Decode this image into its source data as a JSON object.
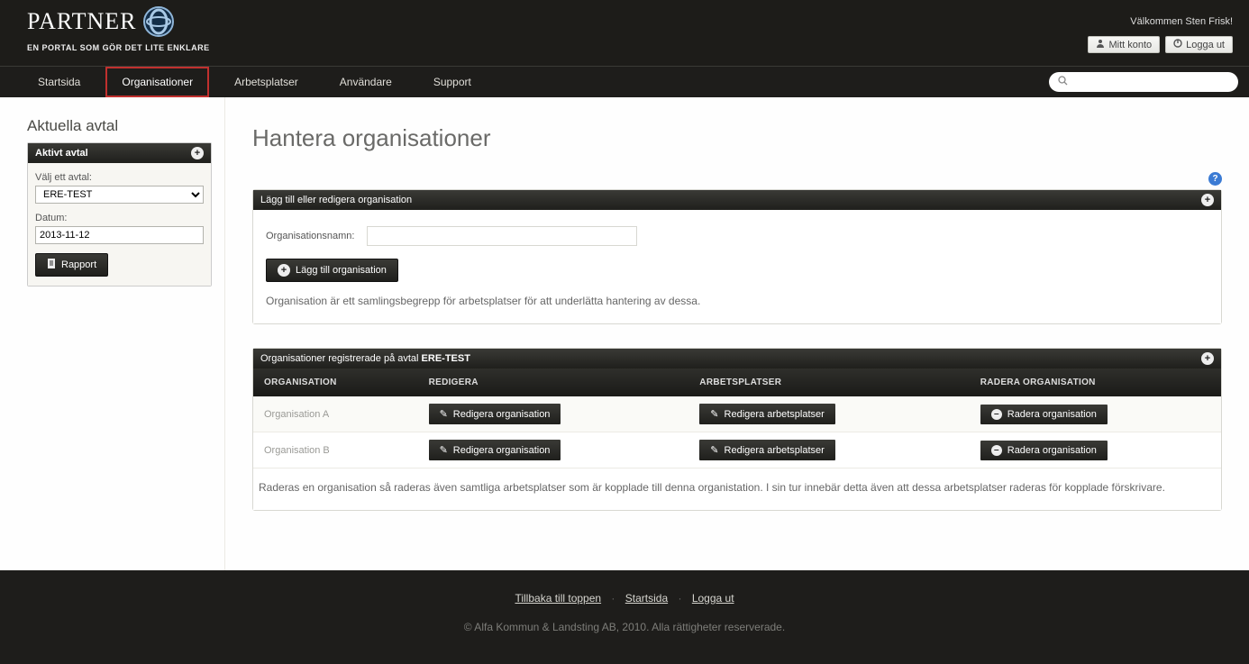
{
  "brand": {
    "title": "PARTNER",
    "sub": "EN PORTAL SOM GÖR DET LITE ENKLARE"
  },
  "header": {
    "welcome": "Välkommen Sten Frisk!",
    "my_account": "Mitt konto",
    "logout": "Logga ut"
  },
  "nav": {
    "startsida": "Startsida",
    "organisationer": "Organisationer",
    "arbetsplatser": "Arbetsplatser",
    "anvandare": "Användare",
    "support": "Support"
  },
  "sidebar": {
    "title": "Aktuella avtal",
    "panel_title": "Aktivt avtal",
    "choose_label": "Välj ett avtal:",
    "selected_contract": "ERE-TEST",
    "date_label": "Datum:",
    "date_value": "2013-11-12",
    "report_btn": "Rapport"
  },
  "main": {
    "title": "Hantera organisationer",
    "add_panel": {
      "head": "Lägg till eller redigera organisation",
      "name_label": "Organisationsnamn:",
      "name_value": "",
      "add_btn": "Lägg till organisation",
      "helper": "Organisation är ett samlingsbegrepp för arbetsplatser för att underlätta hantering av dessa."
    },
    "list_panel": {
      "head_prefix": "Organisationer registrerade på avtal ",
      "head_contract": "ERE-TEST",
      "cols": {
        "org": "ORGANISATION",
        "edit": "REDIGERA",
        "work": "ARBETSPLATSER",
        "del": "RADERA ORGANISATION"
      },
      "edit_btn": "Redigera organisation",
      "work_btn": "Redigera arbetsplatser",
      "del_btn": "Radera organisation",
      "rows": [
        {
          "name": "Organisation A"
        },
        {
          "name": "Organisation B"
        }
      ],
      "footnote": "Raderas en organisation så raderas även samtliga arbetsplatser som är kopplade till denna organistation. I sin tur innebär detta även att dessa arbetsplatser raderas för kopplade förskrivare."
    }
  },
  "footer": {
    "backtotop": "Tillbaka till toppen",
    "startsida": "Startsida",
    "logout": "Logga ut",
    "copy": "© Alfa Kommun & Landsting AB, 2010. Alla rättigheter reserverade."
  }
}
